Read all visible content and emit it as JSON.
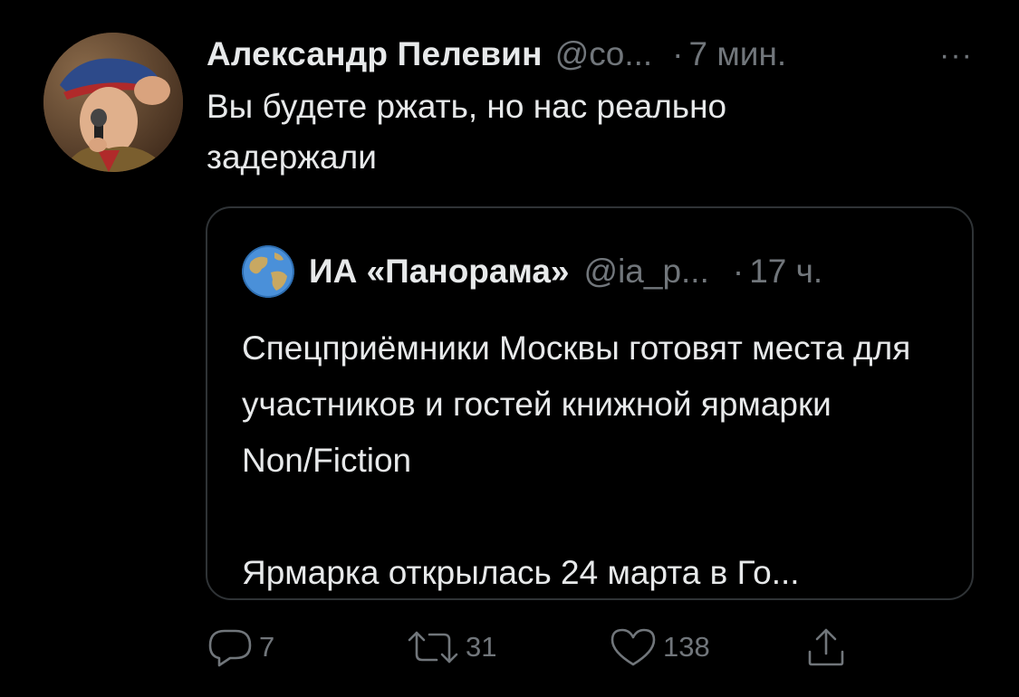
{
  "tweet": {
    "author": {
      "display_name": "Александр Пелевин",
      "handle": "@co...",
      "avatar_icon": "user-photo-avatar"
    },
    "separator": "·",
    "time": "7 мин.",
    "more_label": "···",
    "text": "Вы будете ржать, но нас реально\nзадержали"
  },
  "quote": {
    "author": {
      "display_name": "ИА «Панорама»",
      "handle": "@ia_p...",
      "avatar_icon": "globe-icon"
    },
    "separator": "·",
    "time": "17 ч.",
    "paragraphs": [
      "Спецприёмники Москвы готовят места для участников и гостей книжной ярмарки Non/Fiction",
      "Ярмарка открылась 24 марта в Го..."
    ]
  },
  "actions": {
    "reply_count": "7",
    "retweet_count": "31",
    "like_count": "138"
  },
  "colors": {
    "background": "#000000",
    "text_primary": "#e7e9ea",
    "text_secondary": "#71767b",
    "border": "#2f3336"
  }
}
